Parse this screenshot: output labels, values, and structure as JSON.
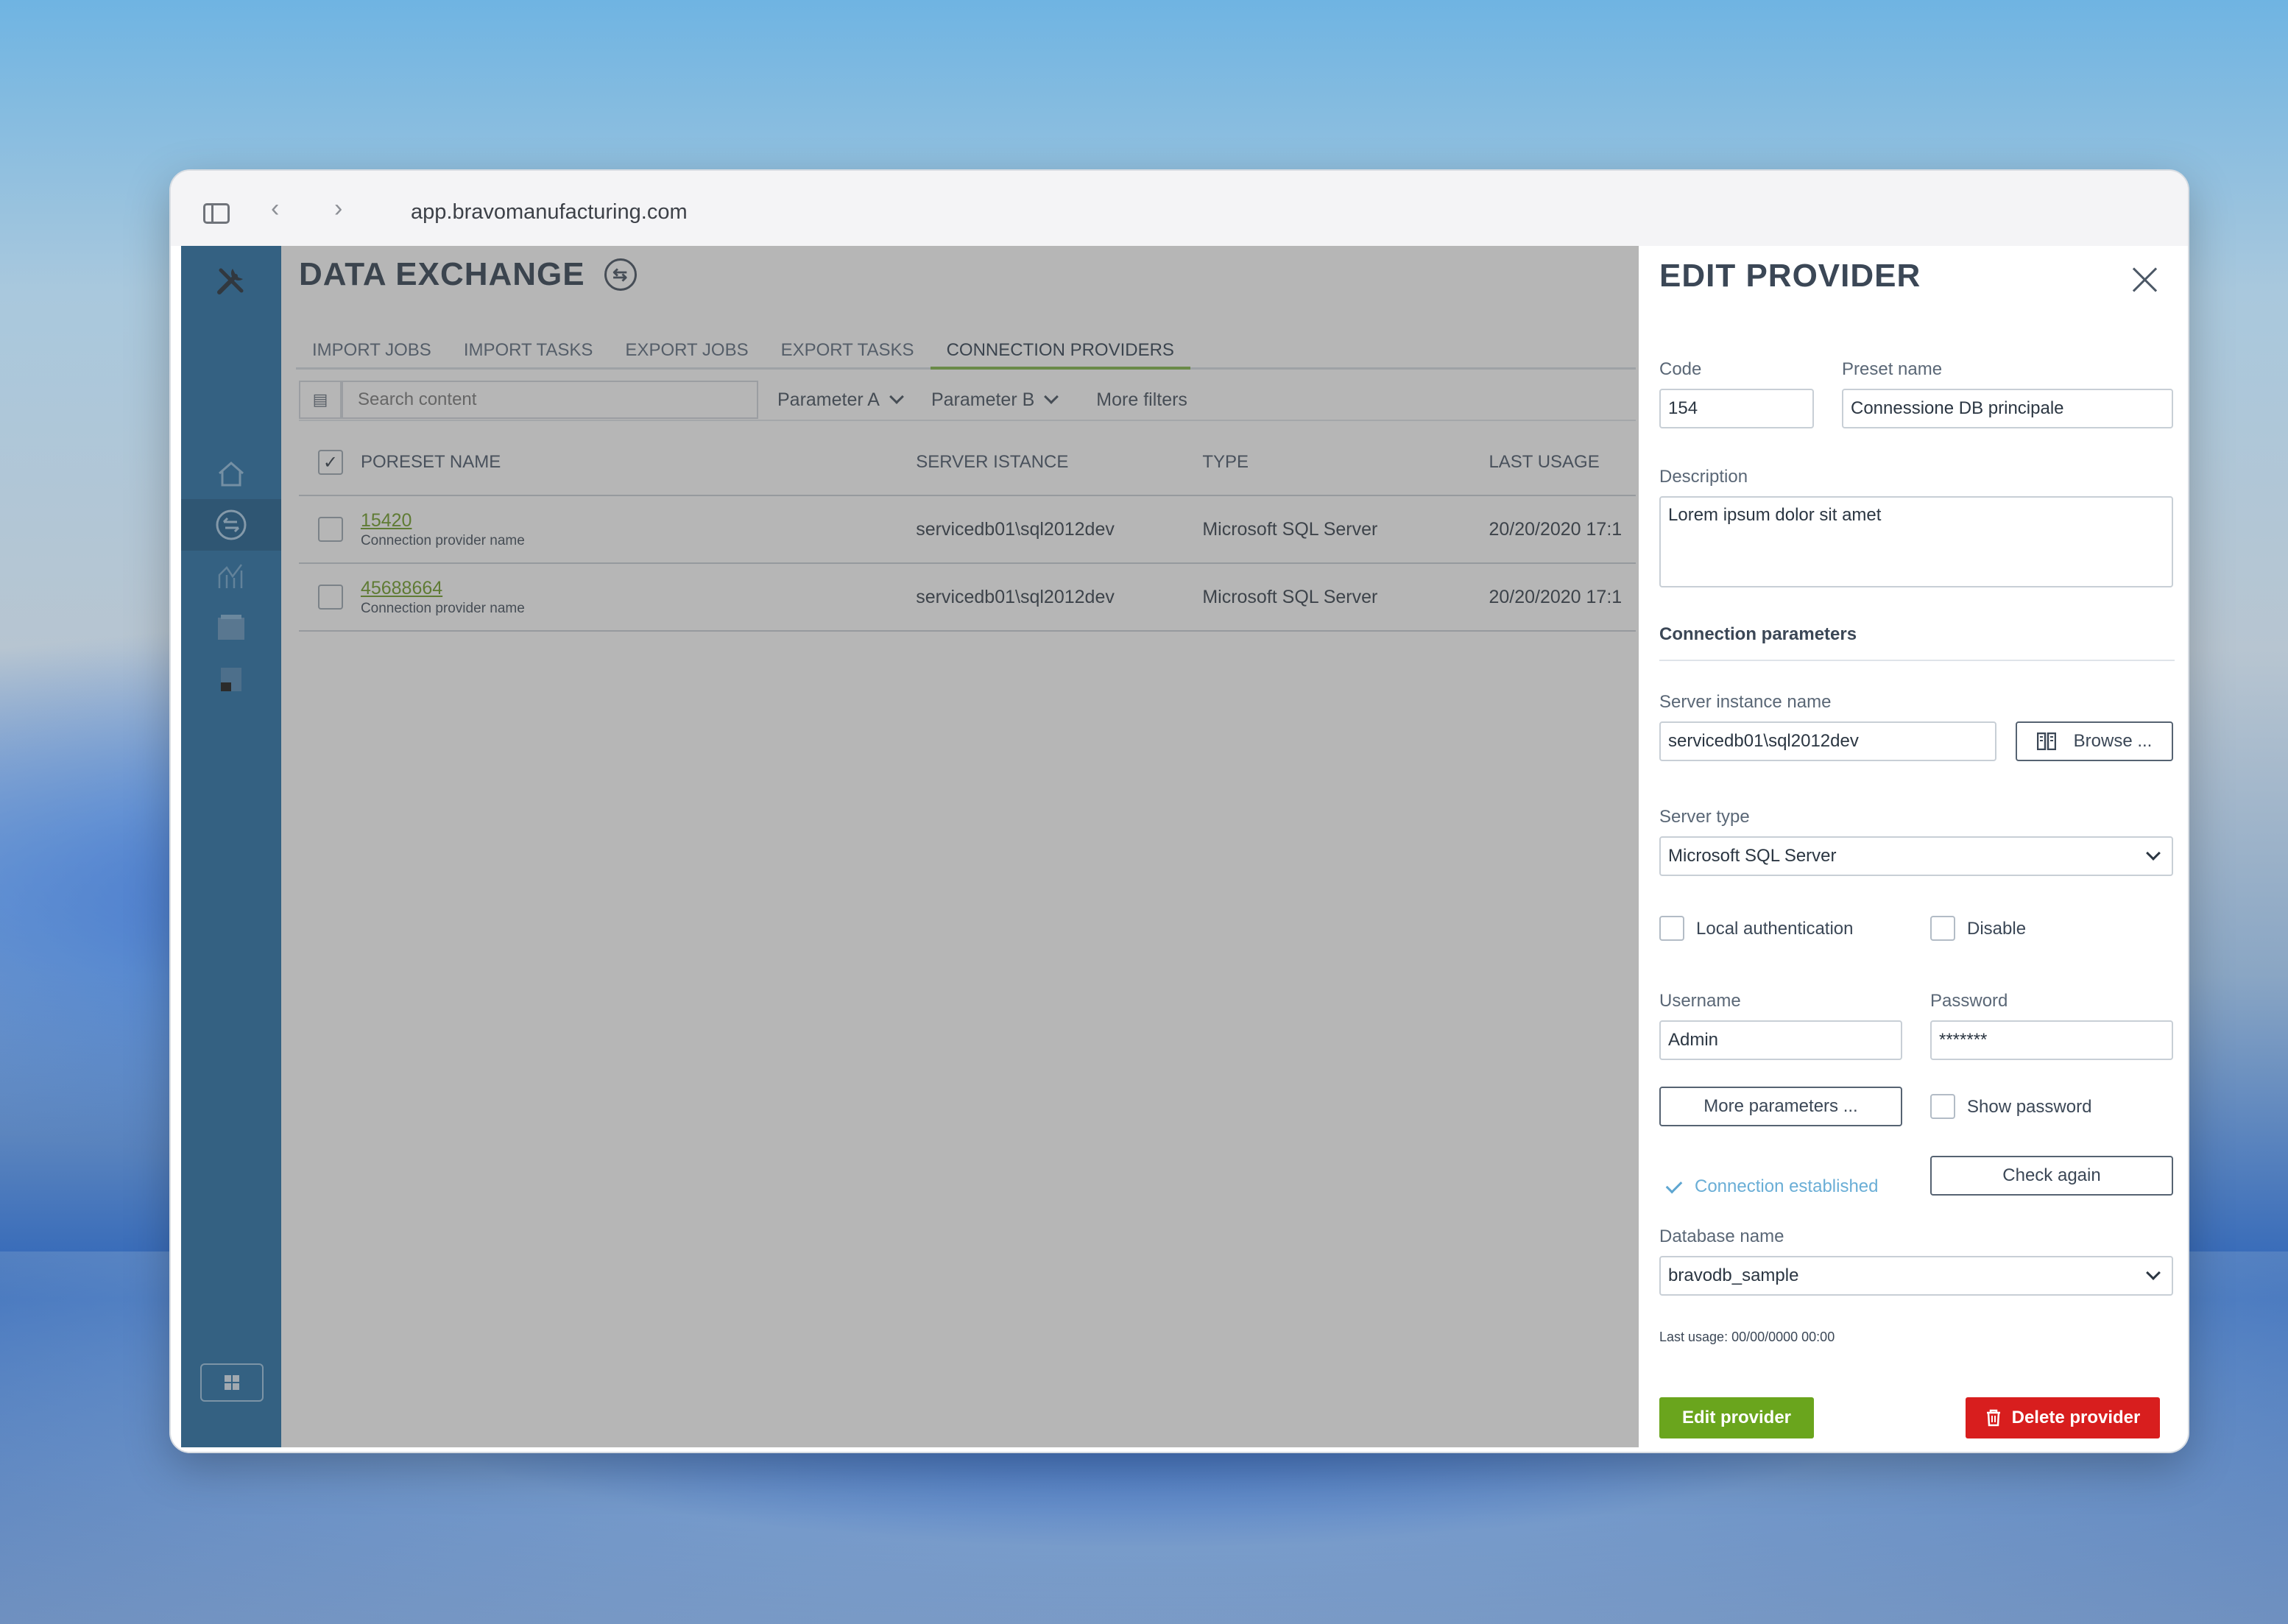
{
  "browser": {
    "url": "app.bravomanufacturing.com"
  },
  "page": {
    "title": "DATA EXCHANGE"
  },
  "tabs": [
    {
      "label": "IMPORT JOBS"
    },
    {
      "label": "IMPORT TASKS"
    },
    {
      "label": "EXPORT JOBS"
    },
    {
      "label": "EXPORT TASKS"
    },
    {
      "label": "CONNECTION PROVIDERS",
      "active": true
    }
  ],
  "toolbar": {
    "search_placeholder": "Search content",
    "param_a": "Parameter A",
    "param_b": "Parameter B",
    "more_filters": "More filters"
  },
  "table": {
    "headers": {
      "name": "PORESET NAME",
      "server": "SERVER ISTANCE",
      "type": "TYPE",
      "last_usage": "LAST USAGE"
    },
    "rows": [
      {
        "code": "15420",
        "sub": "Connection provider name",
        "server": "servicedb01\\sql2012dev",
        "type": "Microsoft SQL Server",
        "last_usage": "20/20/2020 17:1"
      },
      {
        "code": "45688664",
        "sub": "Connection provider name",
        "server": "servicedb01\\sql2012dev",
        "type": "Microsoft SQL Server",
        "last_usage": "20/20/2020 17:1"
      }
    ]
  },
  "panel": {
    "title": "EDIT PROVIDER",
    "code_label": "Code",
    "code_value": "154",
    "preset_label": "Preset name",
    "preset_value": "Connessione DB principale",
    "description_label": "Description",
    "description_value": "Lorem ipsum dolor sit amet",
    "section_title": "Connection parameters",
    "server_instance_label": "Server instance name",
    "server_instance_value": "servicedb01\\sql2012dev",
    "browse_label": "Browse ...",
    "server_type_label": "Server type",
    "server_type_value": "Microsoft SQL Server",
    "local_auth_label": "Local authentication",
    "disable_label": "Disable",
    "username_label": "Username",
    "username_value": "Admin",
    "password_label": "Password",
    "password_value": "*******",
    "more_params_label": "More parameters ...",
    "show_password_label": "Show password",
    "connection_status": "Connection established",
    "check_again_label": "Check again",
    "database_label": "Database name",
    "database_value": "bravodb_sample",
    "last_usage": "Last usage: 00/00/0000 00:00",
    "edit_button": "Edit provider",
    "delete_button": "Delete provider"
  },
  "colors": {
    "rail": "#1f6da6",
    "accent_green": "#6aa51d",
    "danger_red": "#d81e1e",
    "link_green": "#6a9a1f",
    "status_blue": "#6aaed6"
  }
}
